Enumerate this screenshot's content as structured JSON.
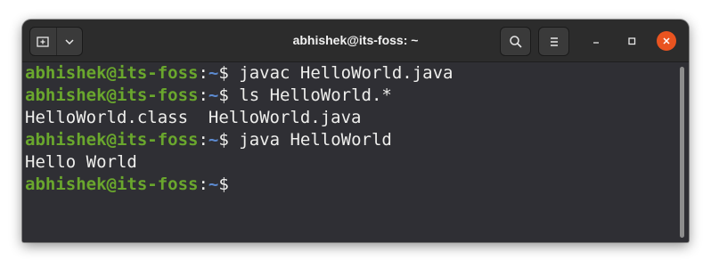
{
  "window": {
    "title": "abhishek@its-foss: ~"
  },
  "titlebar": {
    "new_tab_icon": "new-tab-icon",
    "tab_menu_icon": "chevron-down-icon",
    "search_icon": "search-icon",
    "menu_icon": "hamburger-menu-icon",
    "minimize_icon": "minimize-icon",
    "maximize_icon": "maximize-icon",
    "close_icon": "close-icon"
  },
  "colors": {
    "prompt_user": "#6aa72d",
    "prompt_path": "#5c8ad0",
    "text": "#eeeeec",
    "background": "#2f2f34",
    "close_button": "#e95420"
  },
  "terminal": {
    "prompt": {
      "user_host": "abhishek@its-foss",
      "colon": ":",
      "path": "~",
      "symbol": "$ "
    },
    "lines": [
      {
        "type": "command",
        "text": "javac HelloWorld.java"
      },
      {
        "type": "command",
        "text": "ls HelloWorld.*"
      },
      {
        "type": "output",
        "text": "HelloWorld.class  HelloWorld.java"
      },
      {
        "type": "command",
        "text": "java HelloWorld"
      },
      {
        "type": "output",
        "text": "Hello World"
      },
      {
        "type": "command",
        "text": ""
      }
    ]
  }
}
